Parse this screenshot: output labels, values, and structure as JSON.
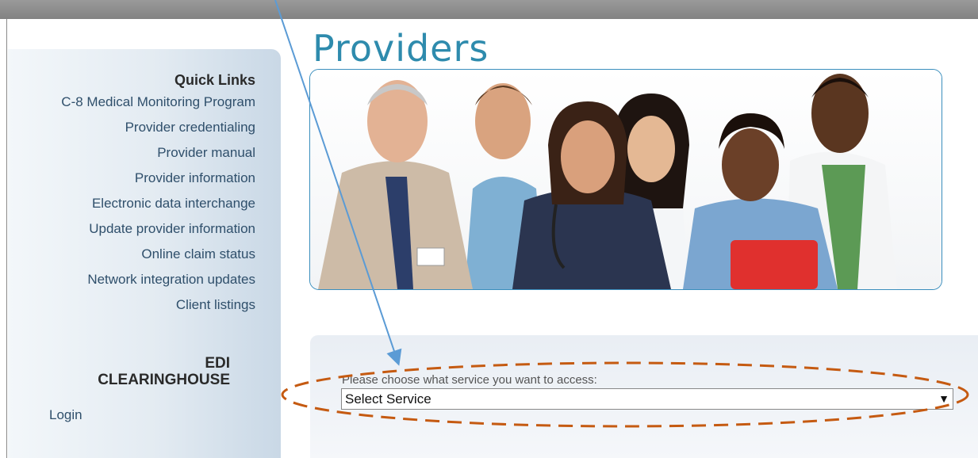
{
  "quick_links": {
    "title": "Quick Links",
    "items": [
      "C-8 Medical Monitoring Program",
      "Provider credentialing",
      "Provider manual",
      "Provider information",
      "Electronic data interchange",
      "Update provider information",
      "Online claim status",
      "Network integration updates",
      "Client listings"
    ]
  },
  "edi": {
    "line1": "EDI",
    "line2": "CLEARINGHOUSE",
    "login": "Login"
  },
  "page": {
    "title": "Providers"
  },
  "service": {
    "label": "Please choose what service you want to access:",
    "selected": "Select Service",
    "arrow": "▼"
  },
  "colors": {
    "title_blue": "#2e8bad",
    "link_color": "#2f4f6b",
    "annotation_arrow": "#5b9bd5",
    "annotation_ellipse": "#c55a11"
  }
}
